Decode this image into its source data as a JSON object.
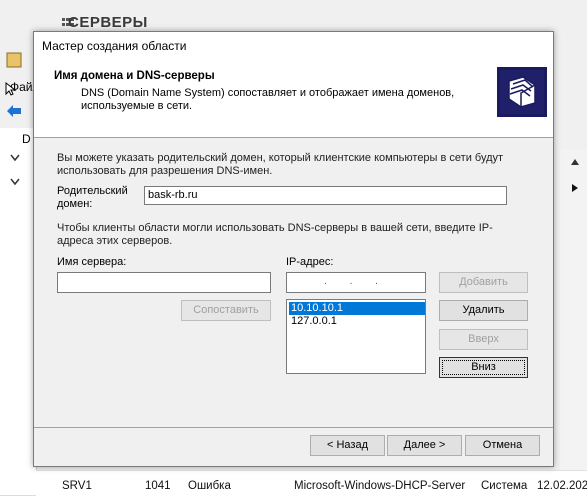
{
  "background": {
    "title": "СЕРВЕРЫ",
    "menu_file": "Файл",
    "bottom_row": {
      "server": "SRV1",
      "event_id": "1041",
      "level": "Ошибка",
      "source": "Microsoft-Windows-DHCP-Server",
      "log": "Система",
      "date": "12.02.202"
    }
  },
  "dialog": {
    "title": "Мастер создания области",
    "header": {
      "title": "Имя домена и DNS-серверы",
      "description": "DNS (Domain Name System) сопоставляет и отображает имена доменов, используемые в сети.",
      "icon": "folder-wizard-icon"
    },
    "intro": "Вы можете указать родительский домен, который клиентские компьютеры в сети будут использовать для разрешения DNS-имен.",
    "parent_domain": {
      "label": "Родительский домен:",
      "value": "bask-rb.ru"
    },
    "dns_intro": "Чтобы клиенты области могли использовать DNS-серверы в вашей сети, введите IP-адреса этих серверов.",
    "server_name": {
      "label": "Имя сервера:",
      "value": ""
    },
    "ip_address": {
      "label": "IP-адрес:",
      "value": ". . ."
    },
    "ip_list": [
      "10.10.10.1",
      "127.0.0.1"
    ],
    "ip_list_selected": 0,
    "buttons": {
      "resolve": "Сопоставить",
      "add": "Добавить",
      "remove": "Удалить",
      "up": "Вверх",
      "down": "Вниз",
      "back": "< Назад",
      "next": "Далее >",
      "cancel": "Отмена"
    }
  }
}
